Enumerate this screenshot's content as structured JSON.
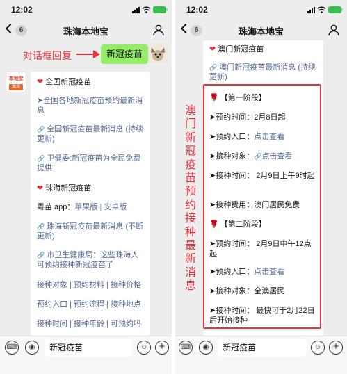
{
  "status_bar": {
    "time": "12:02"
  },
  "nav": {
    "back_badge": "6",
    "title": "珠海本地宝"
  },
  "left": {
    "annotation": "对话框回复",
    "self_message": "新冠疫苗",
    "account_avatar": {
      "line1": "本地宝",
      "line2": "珠海"
    },
    "card": {
      "section1_heading": "全国新冠疫苗",
      "item1": "➤全国各地新冠疫苗预约最新消息",
      "item2": "全国新冠疫苗最新消息 (持续更新)",
      "item3": "卫健委:新冠疫苗为全民免费提供",
      "section2_heading": "珠海新冠疫苗",
      "app_prefix": "粤苗 app：",
      "app_ios": "苹果版",
      "app_sep": " | ",
      "app_android": "安卓版",
      "item4": "珠海新冠疫苗最新消息 (不断更新)",
      "item5": "市卫生健康局：这些珠海人可预约接种新冠疫苗了",
      "links_row1": "接种对象 | 预约材料 | 接种价格",
      "links_row2": "预约入口 | 预约流程 | 接种地点",
      "links_row3": "接种时间 | 接种年龄 | 可预约吗"
    }
  },
  "right": {
    "side_caption": "澳门新冠疫苗预约接种最新消息",
    "card": {
      "heading": "澳门新冠疫苗",
      "news_link": "澳门新冠疫苗最新消息 (持续更新)",
      "stage1_title": "【第一阶段】",
      "s1_time_label": "➤预约时间：",
      "s1_time_value": "2月8日起",
      "s1_entry_label": "➤预约入口：",
      "s1_entry_link": "点击查看",
      "s1_target_label": "➤接种对象：",
      "s1_target_link": "点击查看",
      "s1_vacc_time": "➤接种时间：  2月9日上午9时起",
      "s1_fee_label": "➤接种费用：",
      "s1_fee_value": "澳门居民免费",
      "stage2_title": "【第二阶段】",
      "s2_time": "➤预约时间：  2月9日中午12点起",
      "s2_entry_label": "➤预约入口：",
      "s2_entry_link": "点击查看",
      "s2_target_label": "➤接种对象：",
      "s2_target_value": "全澳居民",
      "s2_vacc_time": "➤接种时间：  最快可于2月22日后开始接种"
    }
  },
  "input_bar": {
    "value": "新冠疫苗"
  },
  "colors": {
    "accent_red": "#e8313a",
    "link_blue": "#576b95",
    "bubble_green": "#95ec69",
    "battery_green": "#38c150"
  },
  "icons": [
    "back-chevron-icon",
    "person-icon",
    "keyboard-icon",
    "voice-icon",
    "emoji-icon",
    "plus-icon",
    "heart-icon",
    "link-icon",
    "flower-icon",
    "arrow-icon"
  ]
}
